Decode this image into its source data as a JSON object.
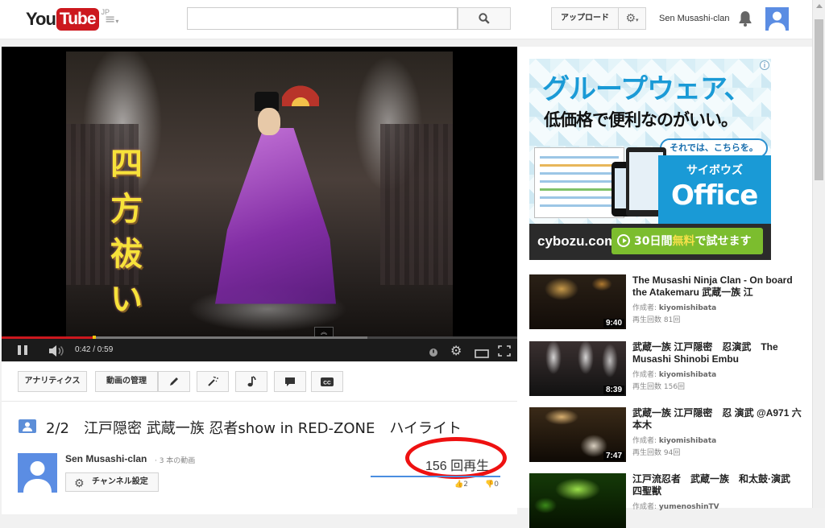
{
  "header": {
    "logo_you": "You",
    "logo_tube": "Tube",
    "logo_region": "JP",
    "search_placeholder": "",
    "upload_label": "アップロード",
    "username": "Sen Musashi-clan"
  },
  "player": {
    "overlay_kanji": [
      "四",
      "方",
      "祓",
      "い"
    ],
    "time": "0:42 / 0:59",
    "progress": 0.18,
    "buffered": 0.71
  },
  "toolbar": {
    "analytics_label": "アナリティクス",
    "manage_label": "動画の管理"
  },
  "info": {
    "title": "2/2　江戸隠密 武蔵一族 忍者show in RED-ZONE　ハイライト",
    "owner_name": "Sen Musashi-clan",
    "owner_video_count": "· 3 本の動画",
    "channel_settings_label": "チャンネル設定",
    "views": "156 回再生",
    "likes": "2",
    "dislikes": "0"
  },
  "ad": {
    "headline": "グループウェア、",
    "subline": "低価格で便利なのがいい。",
    "tag": "それでは、こちらを。",
    "brand_sub": "サイボウズ",
    "brand_main": "Office",
    "brand_url": "cybozu.com",
    "cta_prefix": "30日間",
    "cta_free": "無料",
    "cta_suffix": "で試せます",
    "info": "i"
  },
  "related": [
    {
      "title": "The Musashi Ninja Clan - On board the Atakemaru 武蔵一族 江",
      "by_label": "作成者:",
      "author": "kiyomishibata",
      "views": "再生回数 81回",
      "duration": "9:40"
    },
    {
      "title": "武蔵一族 江戸隠密　忍演武　The Musashi Shinobi Embu",
      "by_label": "作成者:",
      "author": "kiyomishibata",
      "views": "再生回数 156回",
      "duration": "8:39"
    },
    {
      "title": "武蔵一族 江戸隠密　忍 演武 @A971 六本木",
      "by_label": "作成者:",
      "author": "kiyomishibata",
      "views": "再生回数 94回",
      "duration": "7:47"
    },
    {
      "title": "江戸流忍者　武蔵一族　和太鼓·演武　四聖獣",
      "by_label": "作成者:",
      "author": "yumenoshinTV",
      "views": "",
      "duration": ""
    }
  ],
  "colors": {
    "brand_red": "#cc181e",
    "link_blue": "#4a8ee0",
    "annotation_circle": "#ee1111"
  }
}
